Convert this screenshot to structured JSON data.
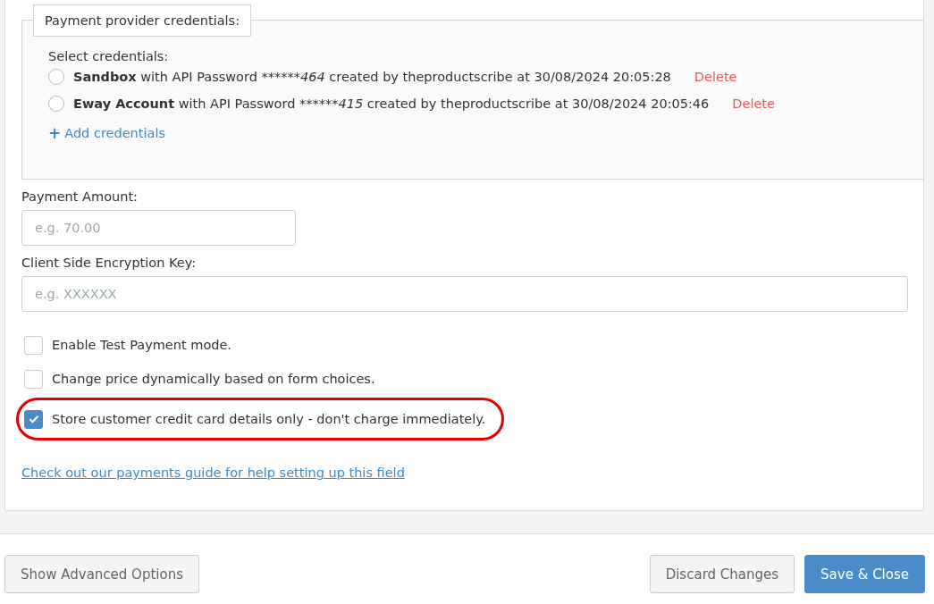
{
  "credentials": {
    "legend": "Payment provider credentials:",
    "prompt": "Select credentials:",
    "items": [
      {
        "name": "Sandbox",
        "middle": "with API Password",
        "masked": "******464",
        "suffix": "created by theproductscribe at 30/08/2024 20:05:28",
        "delete": "Delete",
        "selected": false
      },
      {
        "name": "Eway Account",
        "middle": "with API Password",
        "masked": "******415",
        "suffix": "created by theproductscribe at 30/08/2024 20:05:46",
        "delete": "Delete",
        "selected": false
      }
    ],
    "add": {
      "icon": "+",
      "label": "Add credentials"
    }
  },
  "fields": [
    {
      "label": "Payment Amount:",
      "placeholder": "e.g. 70.00",
      "wide": false
    },
    {
      "label": "Client Side Encryption Key:",
      "placeholder": "e.g. XXXXXX",
      "wide": true
    }
  ],
  "options": [
    {
      "label": "Enable Test Payment mode.",
      "checked": false,
      "highlighted": false
    },
    {
      "label": "Change price dynamically based on form choices.",
      "checked": false,
      "highlighted": false
    },
    {
      "label": "Store customer credit card details only - don't charge immediately.",
      "checked": true,
      "highlighted": true
    }
  ],
  "guide_link": "Check out our payments guide for help setting up this field",
  "footer": {
    "left_buttons": [
      {
        "label": "Show Advanced Options",
        "kind": "default"
      }
    ],
    "right_buttons": [
      {
        "label": "Discard Changes",
        "kind": "default"
      },
      {
        "label": "Save & Close",
        "kind": "primary"
      }
    ]
  }
}
